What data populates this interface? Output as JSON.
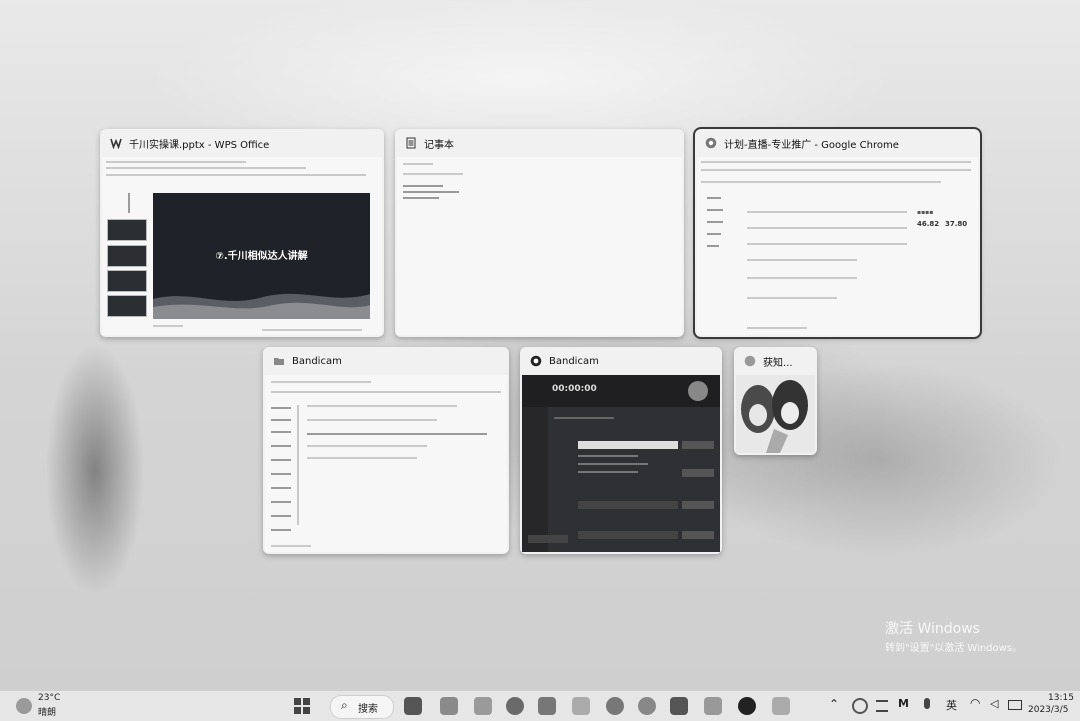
{
  "windows": [
    {
      "id": "wps",
      "title": "千川实操课.pptx - WPS Office",
      "slide_title": "⑦.千川相似达人讲解"
    },
    {
      "id": "notepad",
      "title": "记事本"
    },
    {
      "id": "chrome",
      "title": "计划-直播-专业推广 - Google Chrome",
      "metric_a": "46.82",
      "metric_b": "37.80"
    },
    {
      "id": "bandicam_light",
      "title": "Bandicam"
    },
    {
      "id": "bandicam_dark",
      "title": "Bandicam",
      "timer": "00:00:00"
    },
    {
      "id": "dongzhi",
      "title": "获知..."
    }
  ],
  "taskbar": {
    "weather_temp": "23°C",
    "weather_desc": "晴朗",
    "search_label": "搜索",
    "ime": "英",
    "time": "13:15",
    "date": "2023/3/5"
  },
  "watermark": {
    "line1": "激活 Windows",
    "line2": "转到\"设置\"以激活 Windows。"
  },
  "colors": {
    "desktop": "#d9d9d9",
    "window": "#f1f1f1",
    "slide_bg": "#1f2228",
    "bandicam_dark": "#2f3033",
    "taskbar": "#e6e6e6"
  }
}
